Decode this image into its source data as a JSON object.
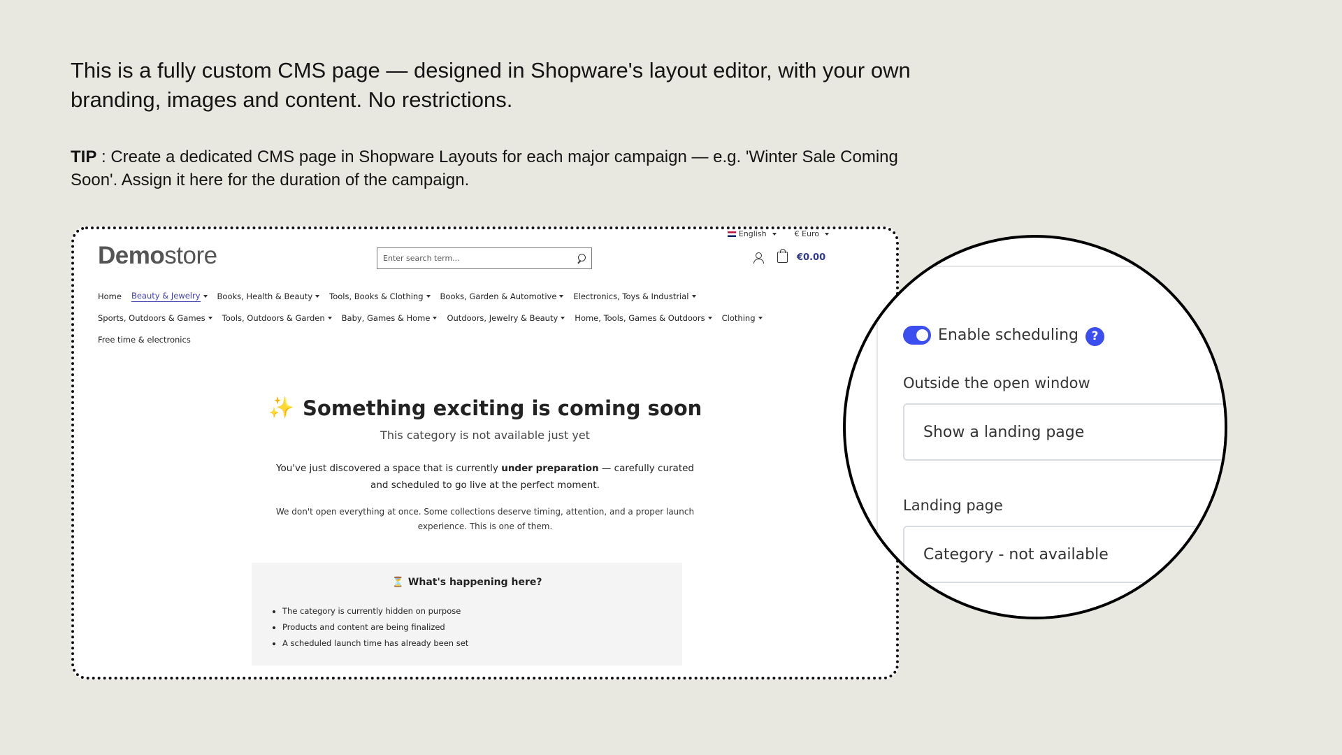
{
  "intro": {
    "text": "This is a fully custom CMS page — designed in Shopware's layout editor, with your own branding, images and content. No restrictions."
  },
  "tip": {
    "label": "TIP",
    "text": " : Create a dedicated CMS page in Shopware Layouts for each major campaign — e.g. 'Winter Sale Coming Soon'. Assign it here for the duration of the campaign."
  },
  "store": {
    "language": "English",
    "currency": "€ Euro",
    "logo_bold": "Demo",
    "logo_light": "store",
    "search_placeholder": "Enter search term...",
    "cart_total": "€0.00",
    "nav_rows": [
      [
        {
          "label": "Home",
          "dropdown": false,
          "active": false
        },
        {
          "label": "Beauty & Jewelry",
          "dropdown": true,
          "active": true
        },
        {
          "label": "Books, Health & Beauty",
          "dropdown": true,
          "active": false
        },
        {
          "label": "Tools, Books & Clothing",
          "dropdown": true,
          "active": false
        },
        {
          "label": "Books, Garden & Automotive",
          "dropdown": true,
          "active": false
        },
        {
          "label": "Electronics, Toys & Industrial",
          "dropdown": true,
          "active": false
        }
      ],
      [
        {
          "label": "Sports, Outdoors & Games",
          "dropdown": true,
          "active": false
        },
        {
          "label": "Tools, Outdoors & Garden",
          "dropdown": true,
          "active": false
        },
        {
          "label": "Baby, Games & Home",
          "dropdown": true,
          "active": false
        },
        {
          "label": "Outdoors, Jewelry & Beauty",
          "dropdown": true,
          "active": false
        },
        {
          "label": "Home, Tools, Games & Outdoors",
          "dropdown": true,
          "active": false
        },
        {
          "label": "Clothing",
          "dropdown": true,
          "active": false
        }
      ],
      [
        {
          "label": "Free time & electronics",
          "dropdown": false,
          "active": false
        }
      ]
    ],
    "hero": {
      "title": "Something exciting is coming soon",
      "subtitle": "This category is not available just yet",
      "p1_before": "You've just discovered a space that is currently ",
      "p1_bold": "under preparation",
      "p1_after": " — carefully curated and scheduled to go live at the perfect moment.",
      "p2": "We don't open everything at once. Some collections deserve timing, attention, and a proper launch experience. This is one of them."
    },
    "info": {
      "title": "What's happening here?",
      "items": [
        "The category is currently hidden on purpose",
        "Products and content are being finalized",
        "A scheduled launch time has already been set"
      ]
    }
  },
  "zoom": {
    "toggle_label": "Enable scheduling",
    "toggle_on": true,
    "help": "?",
    "outside_label": "Outside the open window",
    "outside_value": "Show a landing page",
    "landing_label": "Landing page",
    "landing_value": "Category - not available"
  },
  "colors": {
    "background": "#e8e8e0",
    "accent": "#3b4ef0",
    "nav_active": "#3f3fb0",
    "cart": "#2d3a8c"
  }
}
